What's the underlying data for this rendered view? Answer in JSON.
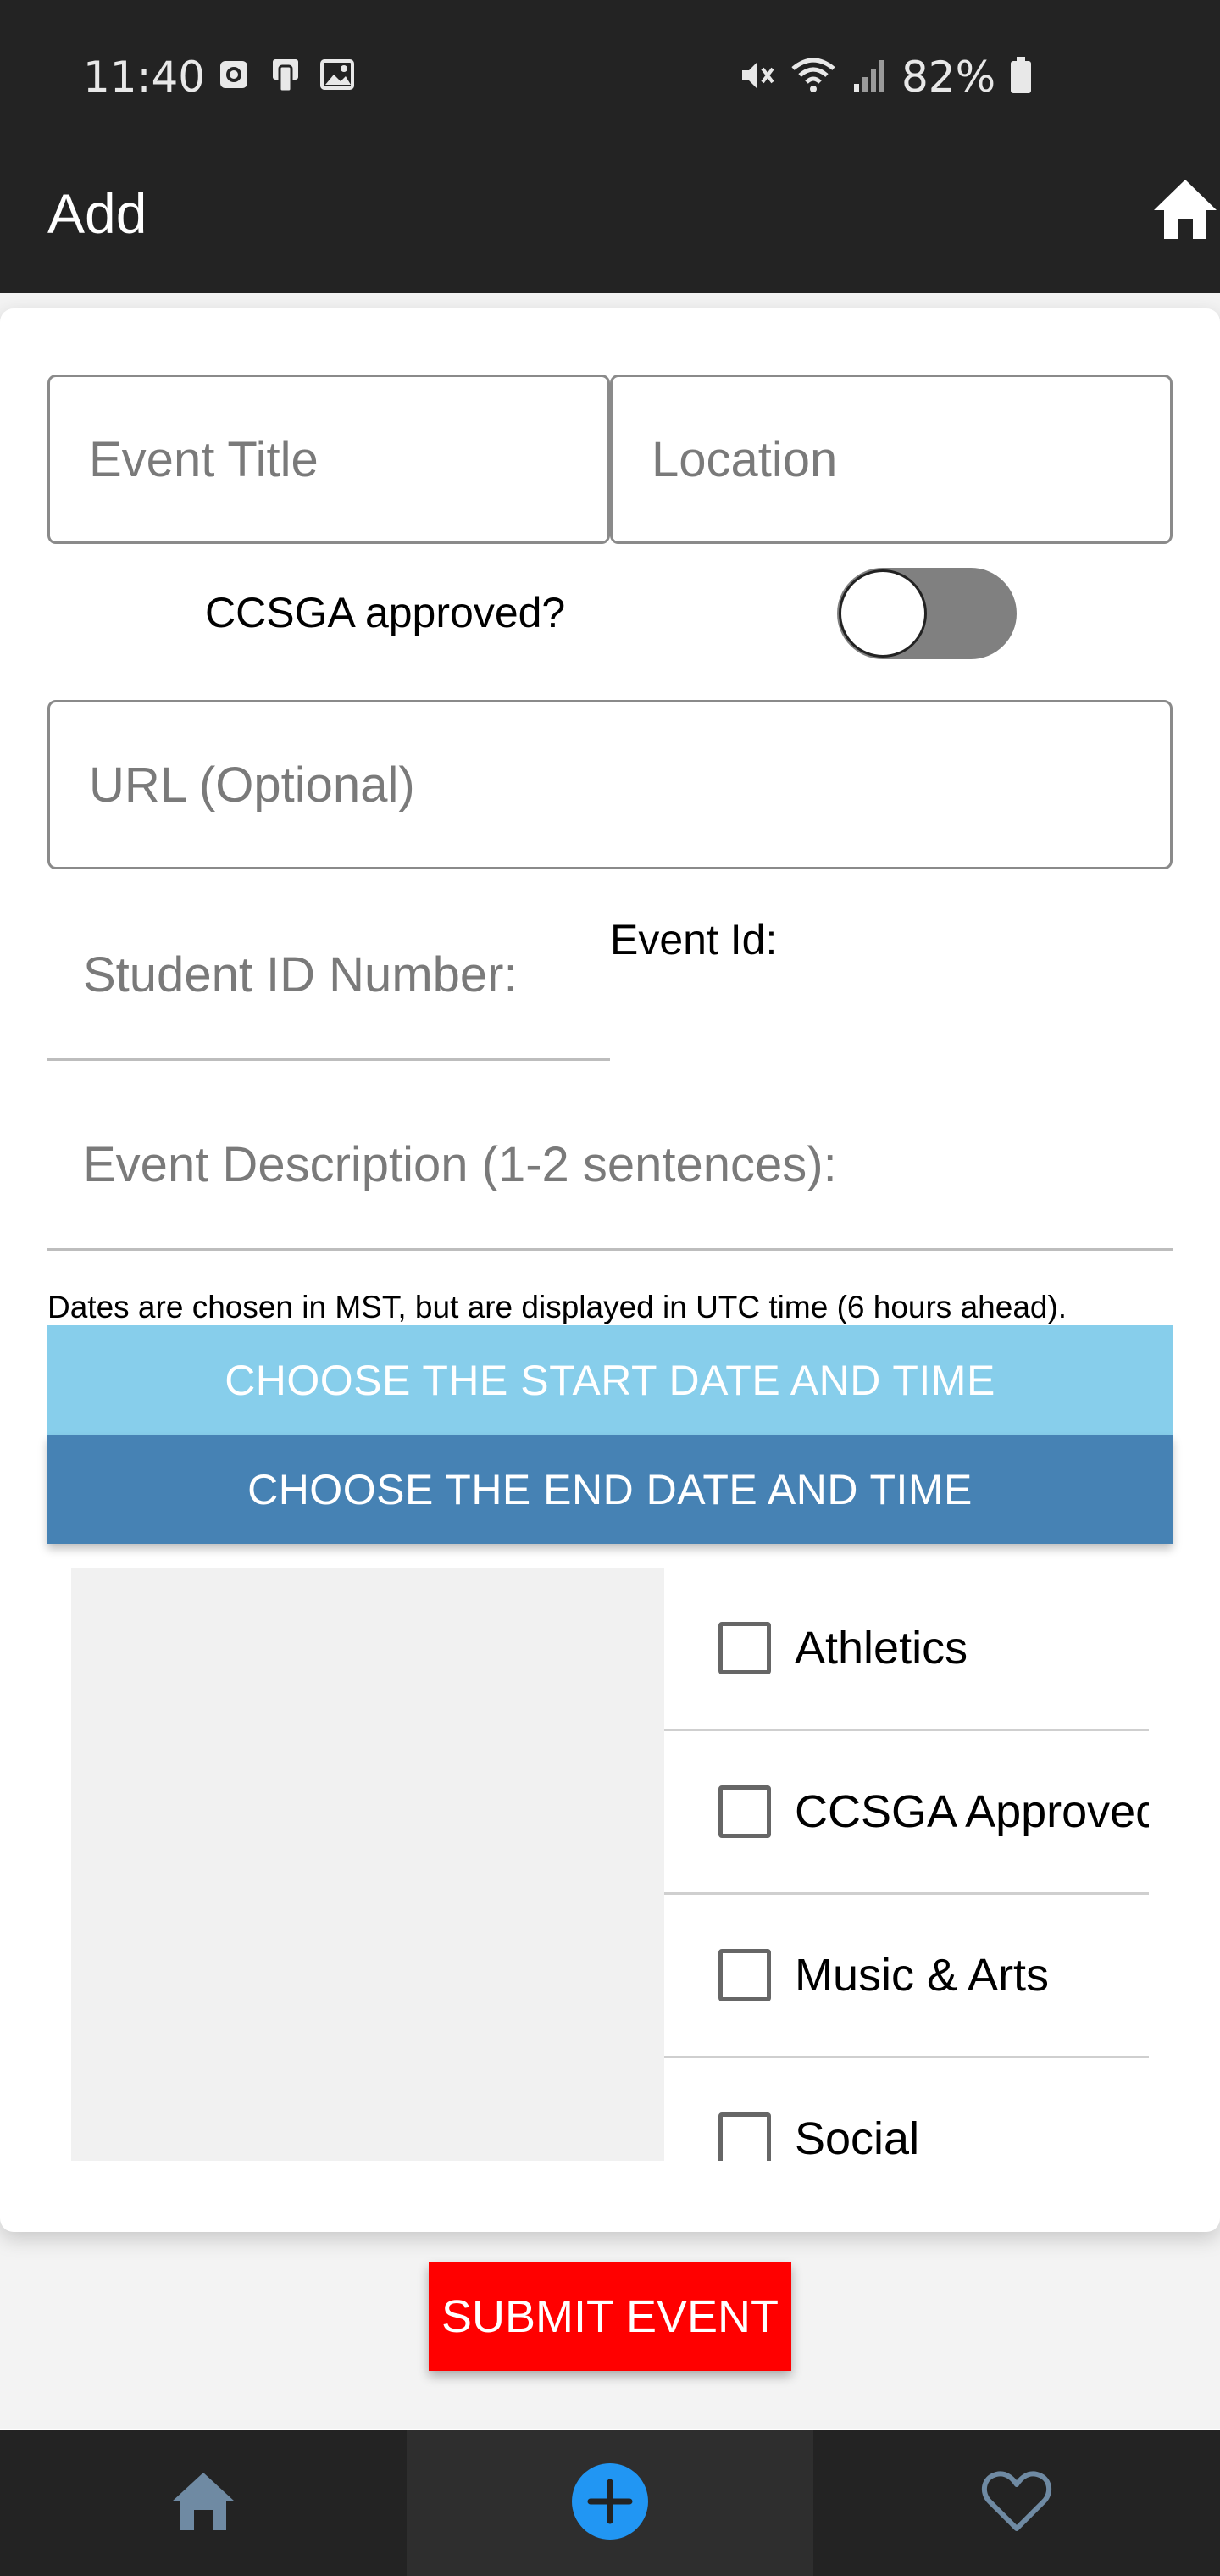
{
  "status_bar": {
    "time": "11:40",
    "battery_percent": "82%",
    "icons_left": [
      "alarm-icon",
      "screen-mirror-icon",
      "gallery-icon"
    ],
    "icons_right": [
      "mute-icon",
      "wifi-icon",
      "signal-icon",
      "battery-icon"
    ]
  },
  "appbar": {
    "title": "Add",
    "home_icon": "home-icon"
  },
  "form": {
    "event_title_placeholder": "Event Title",
    "location_placeholder": "Location",
    "ccsga_label": "CCSGA approved?",
    "ccsga_toggle_on": false,
    "url_placeholder": "URL (Optional)",
    "student_id_placeholder": "Student ID Number:",
    "event_id_label": "Event Id:",
    "description_placeholder": "Event Description (1-2 sentences):",
    "dates_note": "Dates are chosen in MST, but are displayed in UTC time (6 hours ahead).",
    "start_button": "CHOOSE THE START DATE AND TIME",
    "end_button": "CHOOSE THE END DATE AND TIME",
    "categories": [
      {
        "label": "Athletics",
        "checked": false
      },
      {
        "label": "CCSGA Approved",
        "checked": false
      },
      {
        "label": "Music & Arts",
        "checked": false
      },
      {
        "label": "Social",
        "checked": false
      }
    ],
    "submit_button": "SUBMIT EVENT"
  },
  "bottom_nav": {
    "items": [
      {
        "icon": "home-icon",
        "active": false
      },
      {
        "icon": "add-circle-icon",
        "active": true
      },
      {
        "icon": "heart-icon",
        "active": false
      }
    ]
  },
  "colors": {
    "bars": "#232323",
    "start_button": "#87ceeb",
    "end_button": "#4682b4",
    "submit_button": "#ff0000",
    "add_icon": "#2196f3",
    "nav_icon": "#6f8aa3"
  }
}
